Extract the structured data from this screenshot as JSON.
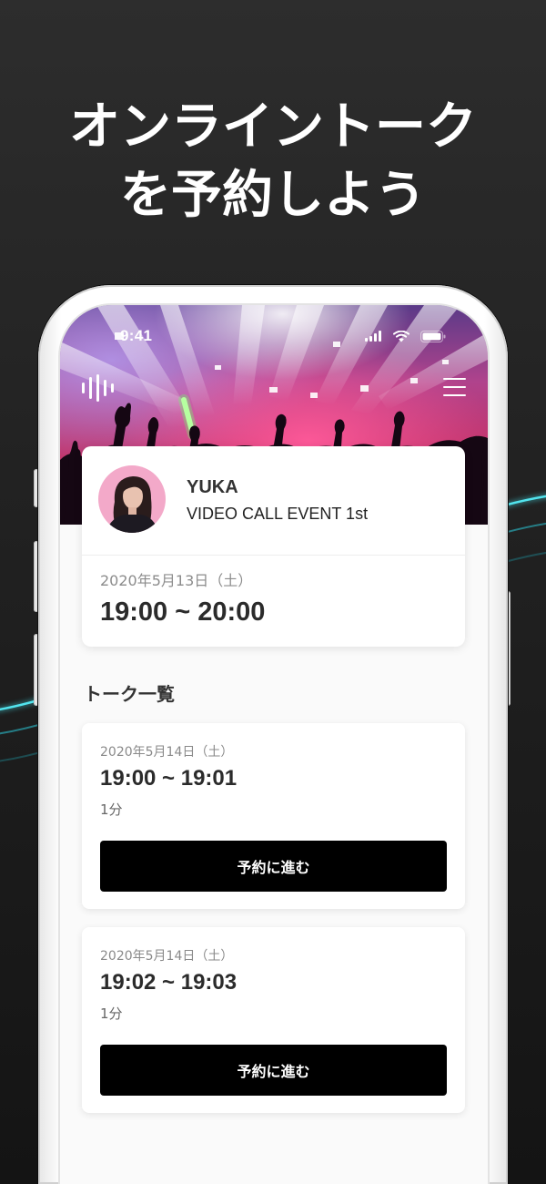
{
  "headline": {
    "line1": "オンライントーク",
    "line2": "を予約しよう"
  },
  "status_bar": {
    "time": "9:41"
  },
  "event": {
    "name": "YUKA",
    "title": "VIDEO CALL EVENT 1st",
    "date": "2020年5月13日（土）",
    "time": "19:00 ~ 20:00"
  },
  "talk_list": {
    "heading": "トーク一覧",
    "items": [
      {
        "date": "2020年5月14日（土）",
        "time": "19:00 ~ 19:01",
        "duration": "1分",
        "button_label": "予約に進む"
      },
      {
        "date": "2020年5月14日（土）",
        "time": "19:02 ~ 19:03",
        "duration": "1分",
        "button_label": "予約に進む"
      }
    ]
  },
  "icons": {
    "status": [
      "signal-icon",
      "wifi-icon",
      "battery-icon"
    ],
    "header_left": "app-logo-icon",
    "header_right": "menu-icon"
  },
  "colors": {
    "background": "#1c1c1c",
    "headline_text": "#ffffff",
    "accent_line": "#3fd6e0",
    "screen_background": "#fafafa",
    "card_background": "#ffffff",
    "button_background": "#000000",
    "button_text": "#ffffff",
    "secondary_text": "#8a8a8a",
    "avatar_backdrop": "#f3a9c9"
  }
}
